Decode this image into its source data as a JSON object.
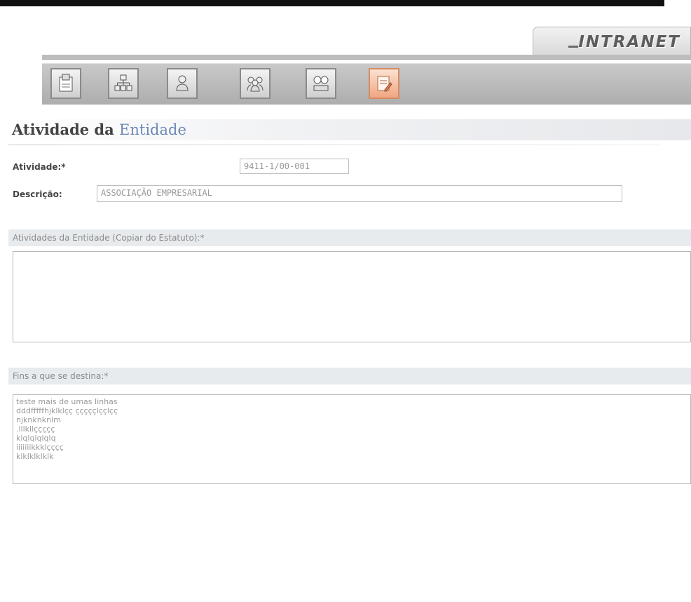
{
  "header": {
    "brand": "INTRANET",
    "nav_icons": [
      {
        "icon": "document-upload-icon",
        "active": false
      },
      {
        "icon": "organization-chart-icon",
        "active": false
      },
      {
        "icon": "person-icon",
        "active": false
      },
      {
        "icon": "group-icon",
        "active": false
      },
      {
        "icon": "meeting-icon",
        "active": false
      },
      {
        "icon": "document-edit-icon",
        "active": true
      }
    ],
    "active_color": "#f1a57f"
  },
  "page": {
    "title_part1": "Atividade da ",
    "title_part2": "Entidade"
  },
  "form": {
    "atividade_label": "Atividade:*",
    "atividade_value": "9411-1/00-001",
    "descricao_label": "Descrição:",
    "descricao_value": "ASSOCIAÇÃO EMPRESARIAL",
    "atividades_section_label": "Atividades da Entidade (Copiar do Estatuto):*",
    "atividades_value": "",
    "fins_section_label": "Fins a que se destina:*",
    "fins_lines": [
      "teste mais de umas linhas",
      "dddfffffhjklklçç çççççlççlçç",
      "njknknknlm",
      ".lllkllççççç",
      "klqlqlqlqlq",
      "iiiiiiikkklçççç",
      "klklklklklk"
    ]
  }
}
